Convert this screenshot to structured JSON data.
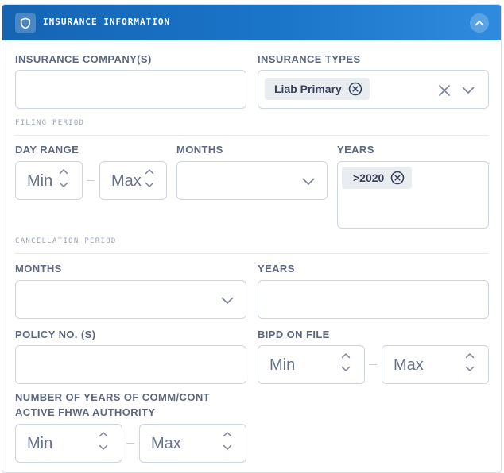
{
  "header": {
    "title": "INSURANCE INFORMATION",
    "shield_icon": "shield-icon",
    "collapse_icon": "chevron-up-icon"
  },
  "fields": {
    "insurance_company": {
      "label": "INSURANCE COMPANY(S)",
      "value": ""
    },
    "insurance_types": {
      "label": "INSURANCE TYPES",
      "chips": [
        "Liab Primary"
      ]
    },
    "filing_period": {
      "section_label": "FILING PERIOD",
      "day_range": {
        "label": "DAY RANGE",
        "min_placeholder": "Min",
        "max_placeholder": "Max"
      },
      "months": {
        "label": "MONTHS",
        "value": ""
      },
      "years": {
        "label": "YEARS",
        "chips": [
          ">2020"
        ]
      }
    },
    "cancellation_period": {
      "section_label": "CANCELLATION PERIOD",
      "months": {
        "label": "MONTHS",
        "value": ""
      },
      "years": {
        "label": "YEARS",
        "value": ""
      }
    },
    "policy_no": {
      "label": "POLICY NO. (S)",
      "value": ""
    },
    "bipd_on_file": {
      "label": "BIPD ON FILE",
      "min_placeholder": "Min",
      "max_placeholder": "Max"
    },
    "years_authority": {
      "label_line1": "NUMBER OF YEARS OF COMM/CONT",
      "label_line2": "ACTIVE FHWA AUTHORITY",
      "min_placeholder": "Min",
      "max_placeholder": "Max"
    }
  },
  "colors": {
    "header_start": "#1664b4",
    "header_end": "#2f8bde",
    "border": "#cfd5de",
    "label": "#5d6880"
  }
}
